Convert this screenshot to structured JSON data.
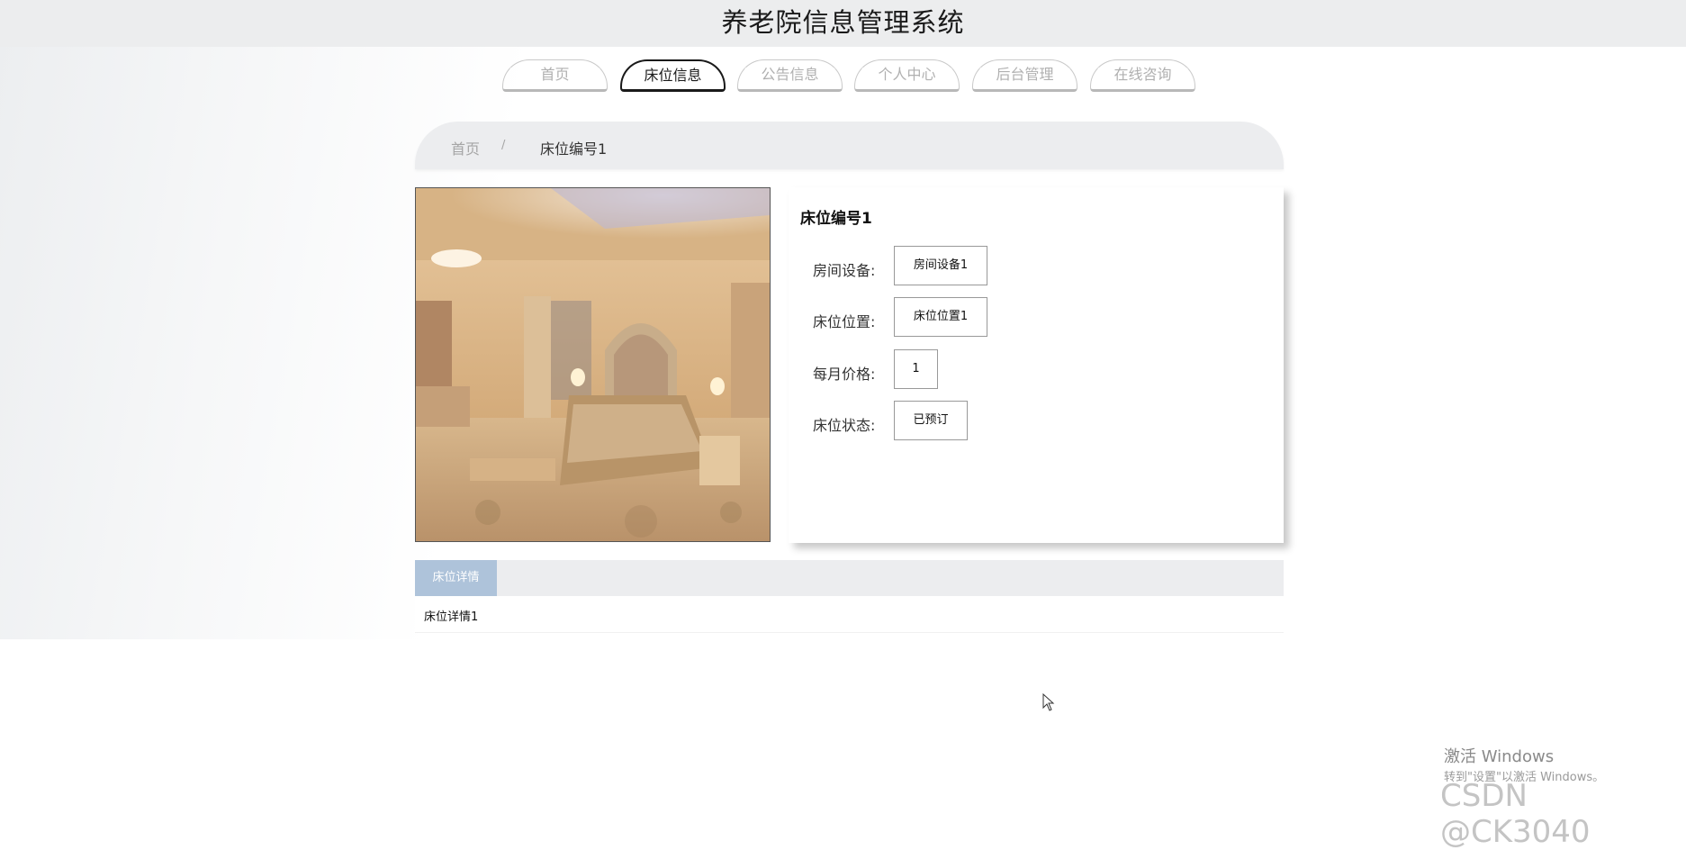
{
  "header": {
    "title": "养老院信息管理系统"
  },
  "nav": {
    "tabs": [
      {
        "label": "首页"
      },
      {
        "label": "床位信息"
      },
      {
        "label": "公告信息"
      },
      {
        "label": "个人中心"
      },
      {
        "label": "后台管理"
      },
      {
        "label": "在线咨询"
      }
    ],
    "active": "床位信息"
  },
  "breadcrumb": {
    "home": "首页",
    "separator": "/",
    "current": "床位编号1"
  },
  "bed": {
    "name": "床位编号1",
    "fields": [
      {
        "label": "房间设备:",
        "value": "房间设备1"
      },
      {
        "label": "床位位置:",
        "value": "床位位置1"
      },
      {
        "label": "每月价格:",
        "value": "1"
      },
      {
        "label": "床位状态:",
        "value": "已预订"
      }
    ]
  },
  "detail": {
    "tab_label": "床位详情",
    "content": "床位详情1"
  },
  "watermark": {
    "windows_title": "激活 Windows",
    "windows_sub": "转到\"设置\"以激活 Windows。",
    "csdn": "CSDN @CK3040"
  },
  "colors": {
    "detail_tab_bg": "#aec3da",
    "header_bg": "#ecedee"
  }
}
